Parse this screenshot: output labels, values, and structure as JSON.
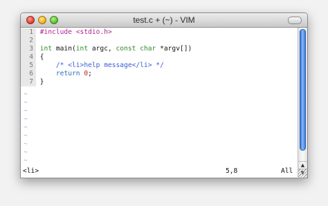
{
  "window": {
    "title": "test.c + (~) - VIM"
  },
  "code_lines": [
    {
      "num": "1",
      "tokens": [
        {
          "t": "#include ",
          "c": "tok-pre"
        },
        {
          "t": "<stdio.h>",
          "c": "tok-inc"
        }
      ]
    },
    {
      "num": "2",
      "tokens": []
    },
    {
      "num": "3",
      "tokens": [
        {
          "t": "int",
          "c": "tok-type"
        },
        {
          "t": " main(",
          "c": "tok-plain"
        },
        {
          "t": "int",
          "c": "tok-type"
        },
        {
          "t": " argc, ",
          "c": "tok-plain"
        },
        {
          "t": "const",
          "c": "tok-type"
        },
        {
          "t": " ",
          "c": "tok-plain"
        },
        {
          "t": "char",
          "c": "tok-type"
        },
        {
          "t": " *argv[])",
          "c": "tok-plain"
        }
      ]
    },
    {
      "num": "4",
      "tokens": [
        {
          "t": "{",
          "c": "tok-plain"
        }
      ]
    },
    {
      "num": "5",
      "tokens": [
        {
          "t": "    ",
          "c": "tok-plain"
        },
        {
          "t": "/* <li>help message</li> */",
          "c": "tok-cmt"
        }
      ]
    },
    {
      "num": "6",
      "tokens": [
        {
          "t": "    ",
          "c": "tok-plain"
        },
        {
          "t": "return",
          "c": "tok-key"
        },
        {
          "t": " ",
          "c": "tok-plain"
        },
        {
          "t": "0",
          "c": "tok-num"
        },
        {
          "t": ";",
          "c": "tok-plain"
        }
      ]
    },
    {
      "num": "7",
      "tokens": [
        {
          "t": "}",
          "c": "tok-plain"
        }
      ]
    }
  ],
  "tilde_char": "~",
  "tilde_count": 10,
  "statusline": {
    "message": "<li>",
    "position": "5,8",
    "percent": "All"
  },
  "scrollbar": {
    "up_arrow": "▲",
    "down_arrow": "▼"
  }
}
